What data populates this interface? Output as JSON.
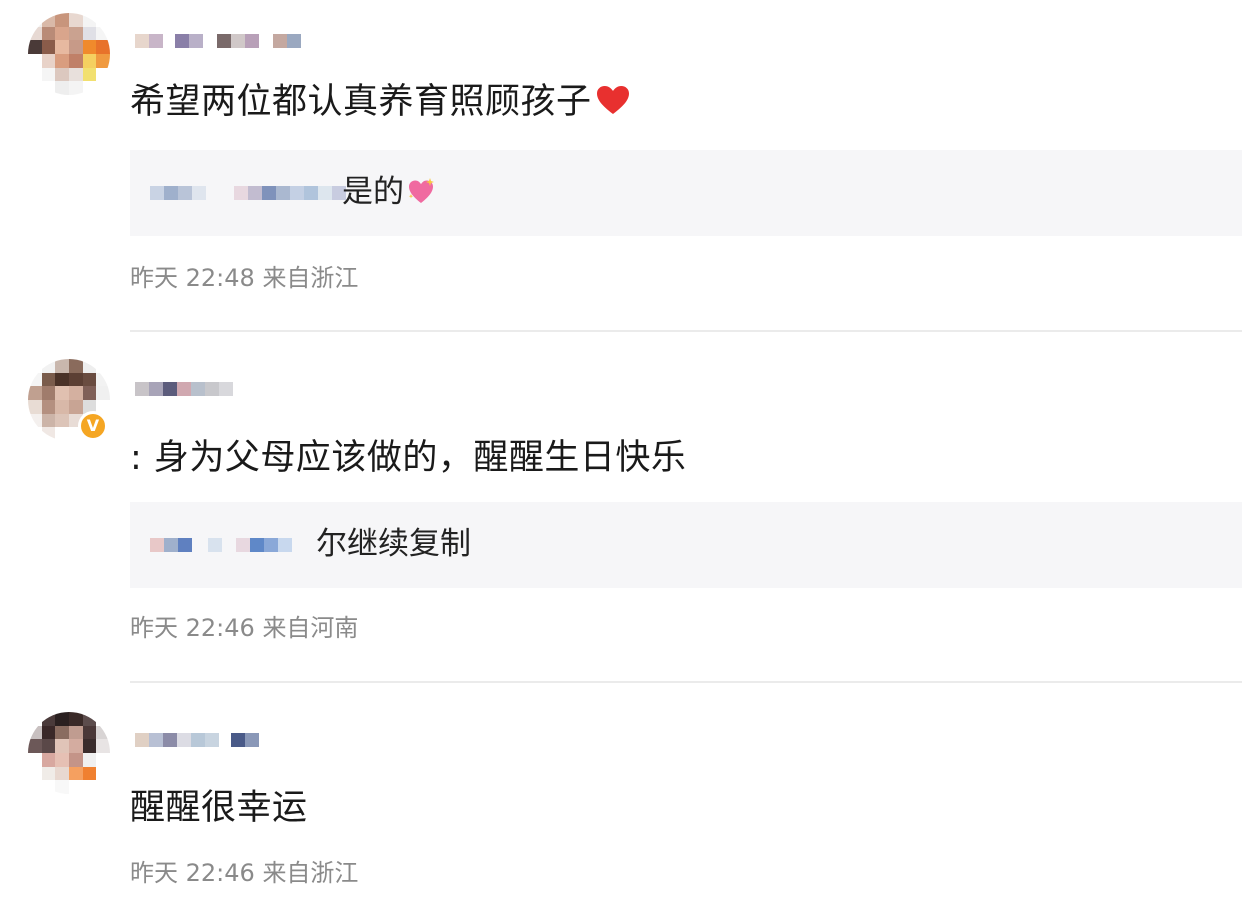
{
  "comments": [
    {
      "text": "希望两位都认真养育照顾孩子",
      "emoji": "red-heart-icon",
      "reply_text": "是的",
      "reply_emoji": "sparkling-heart-icon",
      "time": "昨天 22:48",
      "location": "来自浙江"
    },
    {
      "text": ": 身为父母应该做的，醒醒生日快乐",
      "badge": "V",
      "reply_text": "尔继续复制",
      "time": "昨天 22:46",
      "location": "来自河南"
    },
    {
      "text": "醒醒很幸运",
      "time": "昨天 22:46",
      "location": "来自浙江"
    }
  ],
  "colors": {
    "reply_bg": "#f6f6f8",
    "meta_text": "#8a8a8a",
    "divider": "#ebebeb",
    "badge": "#f5a623",
    "heart": "#e8302f"
  }
}
